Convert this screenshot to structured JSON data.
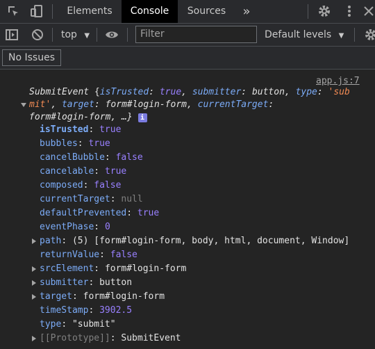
{
  "tabs": {
    "elements": "Elements",
    "console": "Console",
    "sources": "Sources",
    "more": "»"
  },
  "toolbar": {
    "context": "top",
    "filter_placeholder": "Filter",
    "levels": "Default levels"
  },
  "issues": {
    "label": "No Issues"
  },
  "log": {
    "source": "app.js:7",
    "header": {
      "cls": "SubmitEvent",
      "open": " {",
      "k1": "isTrusted",
      "v1": "true",
      "k2": "submitter",
      "v2": "button",
      "k3": "type",
      "v3a": "'sub",
      "v3b": "mit'",
      "k4": "target",
      "v4": "form#login-form",
      "k5": "currentTarget",
      "v5": "form#login-form",
      "close": ", …}",
      "info": "i"
    },
    "props": {
      "isTrusted": {
        "k": "isTrusted",
        "v": "true"
      },
      "bubbles": {
        "k": "bubbles",
        "v": "true"
      },
      "cancelBubble": {
        "k": "cancelBubble",
        "v": "false"
      },
      "cancelable": {
        "k": "cancelable",
        "v": "true"
      },
      "composed": {
        "k": "composed",
        "v": "false"
      },
      "currentTarget": {
        "k": "currentTarget",
        "v": "null"
      },
      "defaultPrevented": {
        "k": "defaultPrevented",
        "v": "true"
      },
      "eventPhase": {
        "k": "eventPhase",
        "v": "0"
      },
      "path": {
        "k": "path",
        "count": "(5)",
        "items": [
          "form#login-form",
          "body",
          "html",
          "document",
          "Window"
        ]
      },
      "returnValue": {
        "k": "returnValue",
        "v": "false"
      },
      "srcElement": {
        "k": "srcElement",
        "v": "form#login-form"
      },
      "submitter": {
        "k": "submitter",
        "v": "button"
      },
      "target": {
        "k": "target",
        "v": "form#login-form"
      },
      "timeStamp": {
        "k": "timeStamp",
        "v": "3902.5"
      },
      "type": {
        "k": "type",
        "v": "\"submit\""
      },
      "prototype": {
        "k": "[[Prototype]]",
        "v": "SubmitEvent"
      }
    }
  }
}
